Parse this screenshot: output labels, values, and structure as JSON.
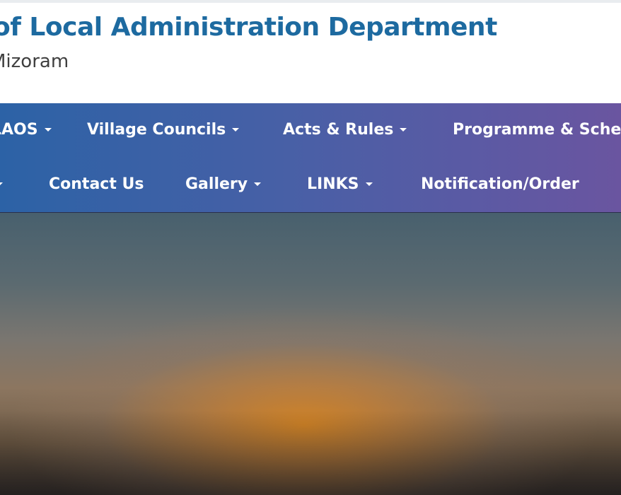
{
  "header": {
    "title": "of Local Administration Department",
    "subtitle": "Mizoram"
  },
  "nav": {
    "row1": [
      {
        "label": "LAOS",
        "dropdown": true
      },
      {
        "label": "Village Councils",
        "dropdown": true
      },
      {
        "label": "Acts & Rules",
        "dropdown": true
      },
      {
        "label": "Programme & Schemes",
        "dropdown": false
      }
    ],
    "row2": [
      {
        "label": "Contact Us",
        "dropdown": false
      },
      {
        "label": "Gallery",
        "dropdown": true
      },
      {
        "label": "LINKS",
        "dropdown": true
      },
      {
        "label": "Notification/Order",
        "dropdown": false
      }
    ]
  },
  "colors": {
    "title": "#1d6aa0",
    "nav_start": "#2c62a6",
    "nav_end": "#6a55a0",
    "hero_glow": "#d68524"
  }
}
